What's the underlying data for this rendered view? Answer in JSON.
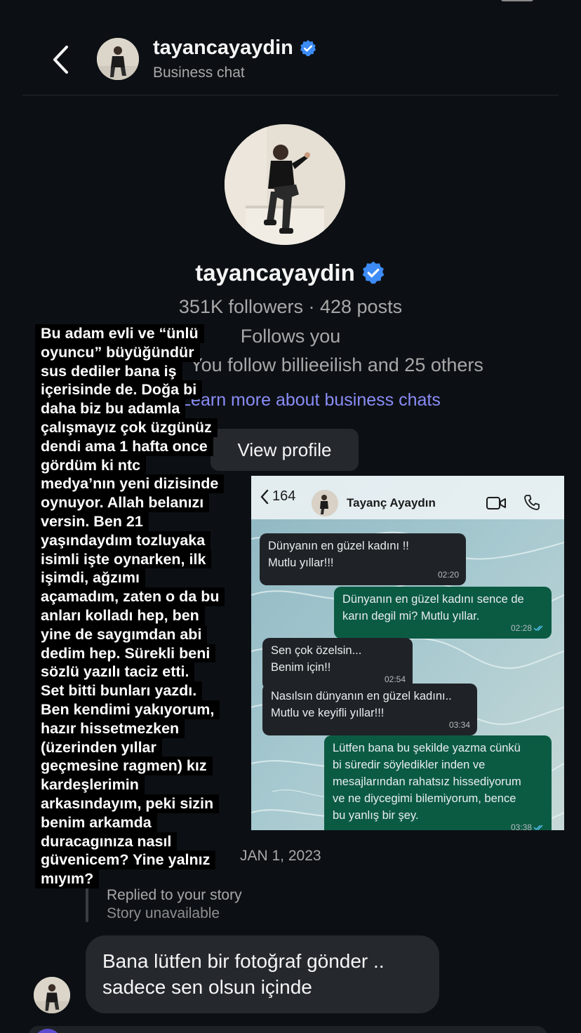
{
  "header": {
    "username": "tayancayaydin",
    "subtitle": "Business chat"
  },
  "profile": {
    "username": "tayancayaydin",
    "stats": "351K followers · 428 posts",
    "follows_you": "Follows you",
    "mutual": "You follow billieeilish and 25 others",
    "link": "Learn more about business chats",
    "view_profile": "View profile"
  },
  "overlay_lines": [
    "Bu adam evli ve “ünlü",
    "oyuncu” büyüğündür",
    "sus dediler bana iş",
    "içerisinde de. Doğa bi",
    "daha biz bu adamla",
    "çalışmayız çok üzgünüz",
    "dendi ama 1 hafta once",
    "gördüm ki ntc",
    "medya’nın yeni dizisinde",
    "oynuyor. Allah belanızı",
    "versin. Ben 21",
    "yaşındaydım tozluyaka",
    "isimli işte oynarken, ilk",
    "işimdi, ağzımı",
    "açamadım, zaten o da bu",
    "anları kolladı hep, ben",
    "yine de saygımdan abi",
    "dedim hep. Sürekli beni",
    "sözlü yazılı taciz etti.",
    "Set bitti bunları yazdı.",
    "Ben kendimi yakıyorum,",
    "hazır hissetmezken",
    "(üzerinden yıllar",
    "geçmesine ragmen) kız",
    "kardeşlerimin",
    "arkasındayım, peki sizin",
    "benim arkamda",
    "duracagınıza nasıl",
    "güvenicem? Yine yalnız",
    "mıyım?"
  ],
  "whatsapp": {
    "back_count": "164",
    "contact_name": "Tayanç Ayaydın",
    "messages": [
      {
        "dir": "in",
        "text": [
          "Dünyanın en güzel kadını !!",
          "Mutlu yıllar!!!"
        ],
        "time": "02:20"
      },
      {
        "dir": "out",
        "text": [
          "Dünyanın en güzel kadını sence de",
          "karın degil mi? Mutlu yıllar."
        ],
        "time": "02:28"
      },
      {
        "dir": "in",
        "text": [
          "Sen çok özelsin...",
          "Benim için!!"
        ],
        "time": "02:54"
      },
      {
        "dir": "in",
        "text": [
          "Nasılsın dünyanın en güzel kadını..",
          "Mutlu ve keyifli yıllar!!!"
        ],
        "time": "03:34"
      },
      {
        "dir": "out",
        "text": [
          "Lütfen bana bu şekilde yazma cünkü",
          "bi süredir söyledikler inden ve",
          "mesajlarından rahatsız hissediyorum",
          "ve ne diycegimi bilemiyorum, bence",
          "bu yanlış bir şey."
        ],
        "time": "03:38"
      }
    ]
  },
  "date_label": "JAN 1, 2023",
  "story": {
    "replied": "Replied to your story",
    "unavailable": "Story unavailable"
  },
  "message": {
    "line1": "Bana lütfen bir fotoğraf gönder  ..",
    "line2": "sadece sen olsun içinde"
  },
  "colors": {
    "background": "#0c1014",
    "verified": "#3d8bf5",
    "link": "#8a8cf6",
    "wa_out": "#0b5b43",
    "wa_in": "#1f2327"
  },
  "icons": [
    "back-chevron-icon",
    "verified-badge-icon",
    "video-call-icon",
    "phone-call-icon",
    "double-check-icon"
  ]
}
